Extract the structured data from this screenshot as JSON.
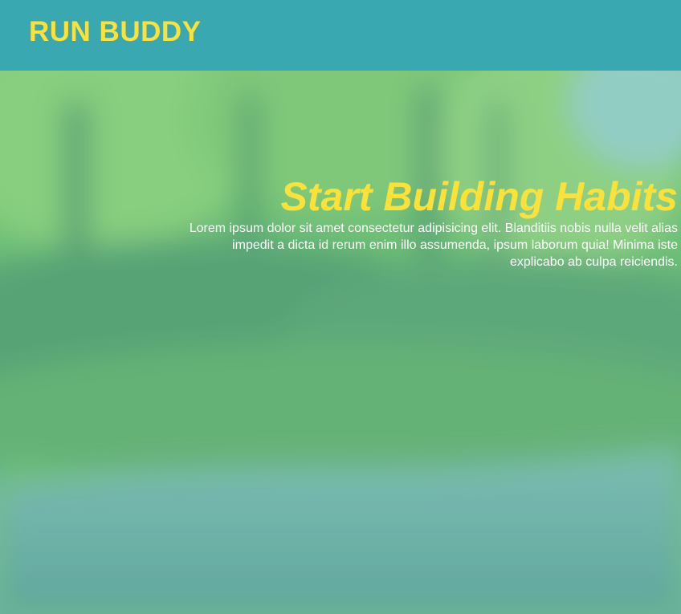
{
  "header": {
    "title": "RUN BUDDY"
  },
  "hero": {
    "title": "Start Building Habits",
    "description": "Lorem ipsum dolor sit amet consectetur adipisicing elit. Blanditiis nobis nulla velit alias impedit a dicta id rerum enim illo assumenda, ipsum laborum quia! Minima iste explicabo ab culpa reiciendis.",
    "background_image": "blurred-forest-road-photo"
  },
  "colors": {
    "header_bg": "#39a8b1",
    "accent_yellow": "#fce138",
    "text_white": "#ffffff"
  }
}
